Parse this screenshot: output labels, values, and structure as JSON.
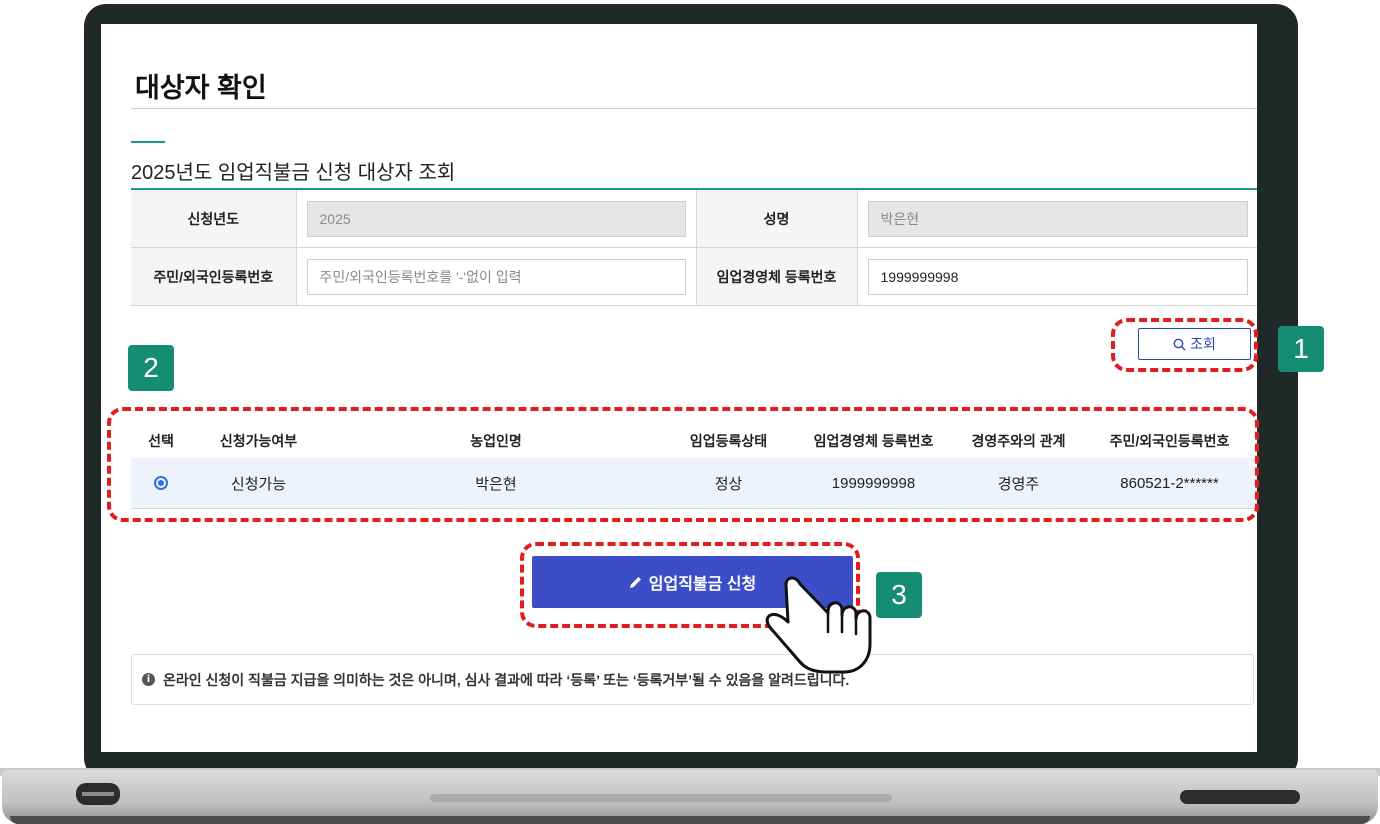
{
  "page": {
    "title": "대상자 확인",
    "section_title": "2025년도 임업직불금 신청 대상자 조회"
  },
  "form": {
    "year_label": "신청년도",
    "year_value": "2025",
    "name_label": "성명",
    "name_value": "박은현",
    "rrn_label": "주민/외국인등록번호",
    "rrn_placeholder": "주민/외국인등록번호를 '-'없이 입력",
    "biz_label": "임업경영체 등록번호",
    "biz_value": "1999999998"
  },
  "search_button": {
    "label": "조회",
    "icon": "search-icon"
  },
  "callouts": {
    "one": "1",
    "two": "2",
    "three": "3"
  },
  "results": {
    "headers": [
      "선택",
      "신청가능여부",
      "농업인명",
      "임업등록상태",
      "임업경영체 등록번호",
      "경영주와의 관계",
      "주민/외국인등록번호"
    ],
    "rows": [
      {
        "selected": true,
        "eligibility": "신청가능",
        "farmer_name": "박은현",
        "status": "정상",
        "biz_no": "1999999998",
        "relation": "경영주",
        "rrn": "860521-2******"
      }
    ]
  },
  "apply_button": {
    "label": "임업직불금 신청",
    "icon": "pencil-icon"
  },
  "notice": {
    "icon": "info-icon",
    "text": "온라인 신청이 직불금 지급을 의미하는 것은 아니며, 심사 결과에 따라 ‘등록’ 또는 ‘등록거부’될 수 있음을 알려드립니다."
  },
  "colors": {
    "accent": "#1a9b8a",
    "primary": "#3c4dc8",
    "callout": "#168d72",
    "highlight": "#e21d1d"
  }
}
